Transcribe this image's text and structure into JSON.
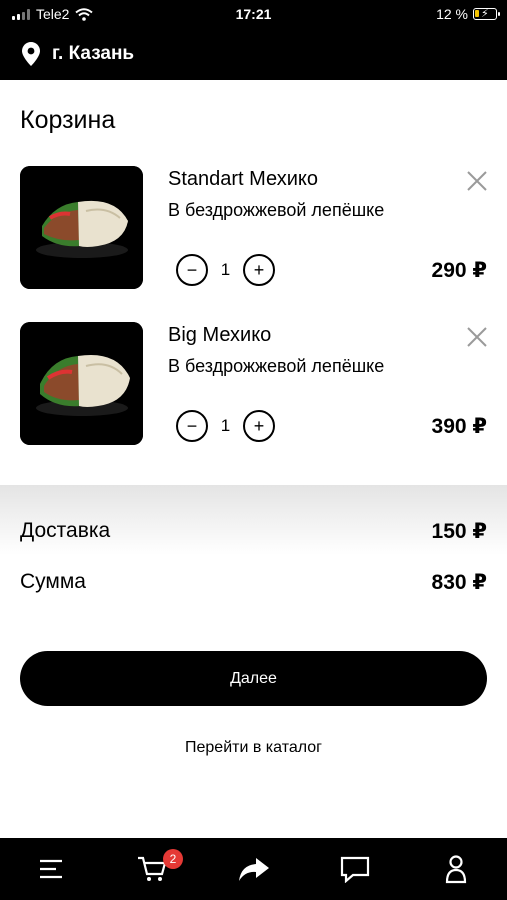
{
  "status_bar": {
    "carrier": "Tele2",
    "time": "17:21",
    "battery": "12 %",
    "icons": [
      "signal-icon",
      "wifi-icon",
      "battery-charging-icon"
    ]
  },
  "header": {
    "city": "г. Казань",
    "icon": "location-pin-icon"
  },
  "page": {
    "title": "Корзина"
  },
  "cart": {
    "items": [
      {
        "name": "Standart Мехико",
        "description": "В бездрожжевой лепёшке",
        "quantity": "1",
        "price": "290 ₽"
      },
      {
        "name": "Big Мехико",
        "description": "В бездрожжевой лепёшке",
        "quantity": "1",
        "price": "390 ₽"
      }
    ]
  },
  "summary": {
    "delivery_label": "Доставка",
    "delivery_amount": "150 ₽",
    "total_label": "Сумма",
    "total_amount": "830 ₽"
  },
  "actions": {
    "next_label": "Далее",
    "catalog_label": "Перейти в каталог"
  },
  "tab_bar": {
    "cart_badge": "2",
    "tabs": [
      "menu-icon",
      "cart-icon",
      "share-icon",
      "chat-icon",
      "profile-icon"
    ]
  },
  "colors": {
    "bar_background": "#000000",
    "badge": "#e53935"
  }
}
